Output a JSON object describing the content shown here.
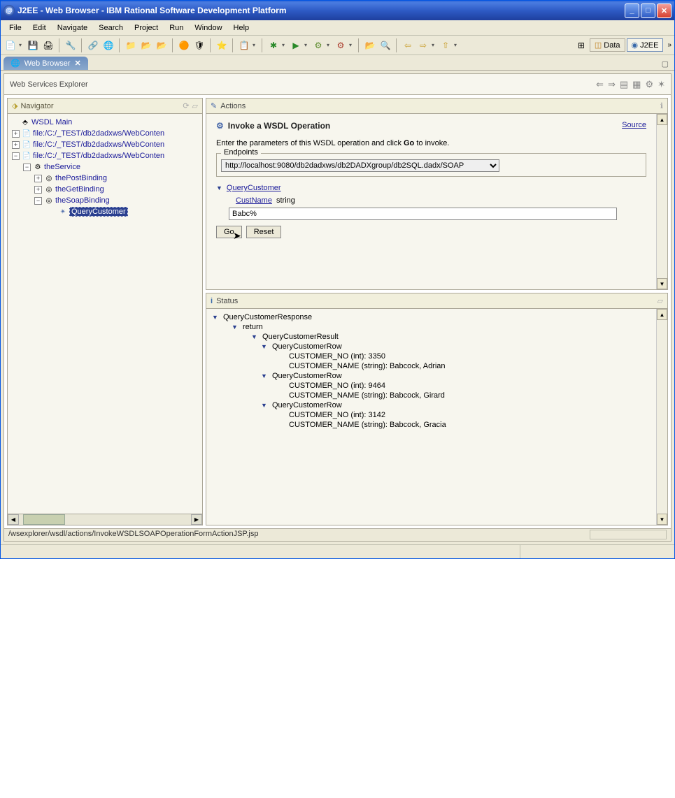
{
  "window": {
    "title": "J2EE - Web Browser - IBM Rational Software Development Platform"
  },
  "menubar": [
    "File",
    "Edit",
    "Navigate",
    "Search",
    "Project",
    "Run",
    "Window",
    "Help"
  ],
  "perspectives": {
    "data": "Data",
    "j2ee": "J2EE"
  },
  "tab": {
    "label": "Web Browser"
  },
  "explorer": {
    "title": "Web Services Explorer"
  },
  "navigator": {
    "title": "Navigator",
    "root": "WSDL Main",
    "files": [
      "file:/C:/_TEST/db2dadxws/WebConten",
      "file:/C:/_TEST/db2dadxws/WebConten",
      "file:/C:/_TEST/db2dadxws/WebConten"
    ],
    "service": "theService",
    "bindings": [
      "thePostBinding",
      "theGetBinding",
      "theSoapBinding"
    ],
    "operation": "QueryCustomer"
  },
  "actions": {
    "title": "Actions",
    "heading": "Invoke a WSDL Operation",
    "source_link": "Source",
    "desc_prefix": "Enter the parameters of this WSDL operation and click ",
    "desc_bold": "Go",
    "desc_suffix": " to invoke.",
    "endpoints_label": "Endpoints",
    "endpoint_value": "http://localhost:9080/db2dadxws/db2DADXgroup/db2SQL.dadx/SOAP",
    "operation_name": "QueryCustomer",
    "param_name": "CustName",
    "param_type": "string",
    "param_value": "Babc%",
    "go": "Go",
    "reset": "Reset"
  },
  "status": {
    "title": "Status",
    "response": "QueryCustomerResponse",
    "return": "return",
    "result": "QueryCustomerResult",
    "row": "QueryCustomerRow",
    "rows": [
      {
        "no": "CUSTOMER_NO (int): 3350",
        "name": "CUSTOMER_NAME (string): Babcock, Adrian"
      },
      {
        "no": "CUSTOMER_NO (int): 9464",
        "name": "CUSTOMER_NAME (string): Babcock, Girard"
      },
      {
        "no": "CUSTOMER_NO (int): 3142",
        "name": "CUSTOMER_NAME (string): Babcock, Gracia"
      }
    ]
  },
  "statusbar": "/wsexplorer/wsdl/actions/InvokeWSDLSOAPOperationFormActionJSP.jsp"
}
